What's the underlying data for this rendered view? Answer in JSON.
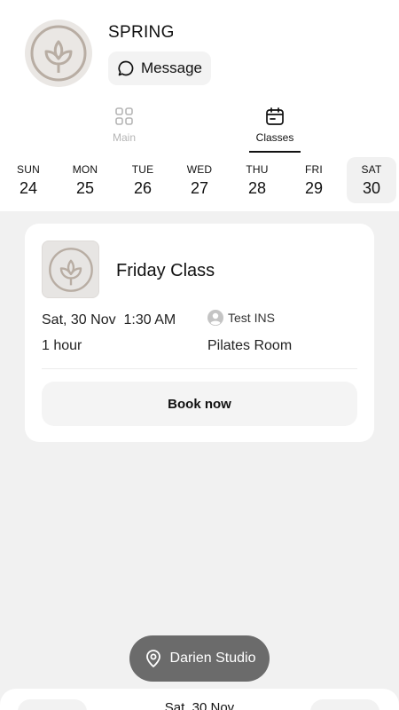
{
  "studio": {
    "name": "SPRING",
    "message_label": "Message"
  },
  "tabs": [
    {
      "label": "Main",
      "icon": "grid-icon",
      "active": false
    },
    {
      "label": "Classes",
      "icon": "calendar-icon",
      "active": true
    }
  ],
  "week": [
    {
      "day": "SUN",
      "date": "24"
    },
    {
      "day": "MON",
      "date": "25"
    },
    {
      "day": "TUE",
      "date": "26"
    },
    {
      "day": "WED",
      "date": "27"
    },
    {
      "day": "THU",
      "date": "28"
    },
    {
      "day": "FRI",
      "date": "29"
    },
    {
      "day": "SAT",
      "date": "30",
      "selected": true
    }
  ],
  "class_card": {
    "title": "Friday Class",
    "date": "Sat, 30 Nov",
    "time": "1:30 AM",
    "duration": "1 hour",
    "instructor": "Test INS",
    "room": "Pilates Room",
    "book_label": "Book now"
  },
  "location": {
    "label": "Darien Studio"
  },
  "bottom_sheet": {
    "date": "Sat, 30 Nov"
  },
  "colors": {
    "background": "#f1f1f1",
    "accent": "#111111",
    "pill": "#6b6b6b",
    "logo": "#b8ada3"
  }
}
